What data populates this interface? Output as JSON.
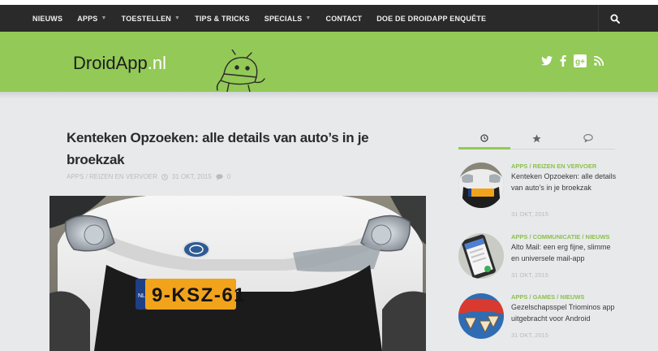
{
  "nav": {
    "items": [
      {
        "label": "NIEUWS",
        "dropdown": false
      },
      {
        "label": "APPS",
        "dropdown": true
      },
      {
        "label": "TOESTELLEN",
        "dropdown": true
      },
      {
        "label": "TIPS & TRICKS",
        "dropdown": false
      },
      {
        "label": "SPECIALS",
        "dropdown": true
      },
      {
        "label": "CONTACT",
        "dropdown": false
      },
      {
        "label": "DOE DE DROIDAPP ENQUÊTE",
        "dropdown": false
      }
    ],
    "search_icon": "search-icon"
  },
  "header": {
    "brand": "DroidApp",
    "brand_tld": ".nl",
    "social_icons": [
      "twitter-icon",
      "facebook-icon",
      "google-plus-icon",
      "rss-icon"
    ]
  },
  "article": {
    "title": "Kenteken Opzoeken: alle details van auto’s in je broekzak",
    "category": "APPS / REIZEN EN VERVOER",
    "date": "31 OKT, 2015",
    "comments": "0",
    "plate_country": "NL",
    "plate_text": "9-KSZ-61"
  },
  "sidebar": {
    "tabs": [
      "clock-icon",
      "star-icon",
      "comments-icon"
    ],
    "posts": [
      {
        "category": "APPS / REIZEN EN VERVOER",
        "title": "Kenteken Opzoeken: alle details van auto’s in je broekzak",
        "date": "31 OKT, 2015"
      },
      {
        "category": "APPS / COMMUNICATIE / NIEUWS",
        "title": "Alto Mail: een erg fijne, slimme en universele mail-app",
        "date": "31 OKT, 2015"
      },
      {
        "category": "APPS / GAMES / NIEUWS",
        "title": "Gezelschapsspel Triominos app uitgebracht voor Android",
        "date": "31 OKT, 2015"
      }
    ]
  },
  "colors": {
    "accent_green": "#93c956",
    "nav_bg": "#2a2a2a",
    "content_bg": "#e7e9eb"
  }
}
